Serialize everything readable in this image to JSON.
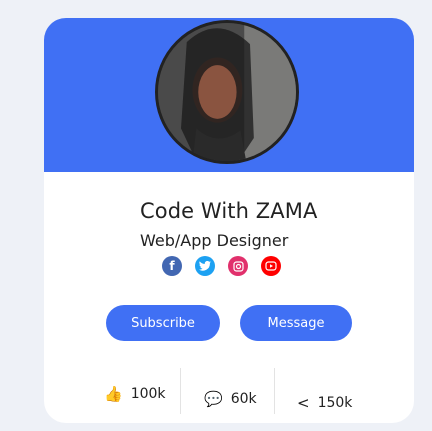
{
  "profile": {
    "name": "Code With ZAMA",
    "role": "Web/App Designer"
  },
  "social": {
    "facebook": "f",
    "twitter": "t",
    "instagram": "ig",
    "youtube": "yt"
  },
  "buttons": {
    "subscribe": "Subscribe",
    "message": "Message"
  },
  "stats": [
    {
      "icon": "thumbs-up-icon",
      "value": "100k"
    },
    {
      "icon": "comment-icon",
      "value": "60k"
    },
    {
      "icon": "share-icon",
      "value": "150k"
    }
  ],
  "colors": {
    "accent": "#4070f4",
    "facebook": "#4267b2",
    "twitter": "#1da1f2",
    "instagram": "#e1306c",
    "youtube": "#ff0000"
  }
}
